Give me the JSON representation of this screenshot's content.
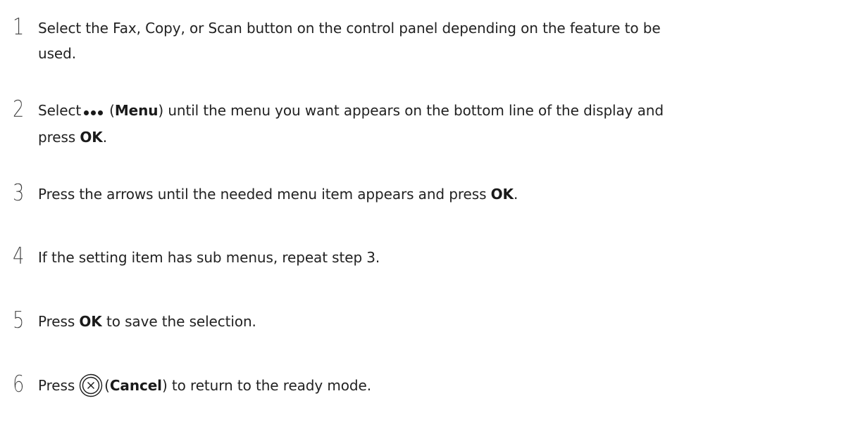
{
  "steps": [
    {
      "number": "1",
      "line1": "Select the Fax, Copy, or Scan button on the control panel depending on the feature to be",
      "line2": "used."
    },
    {
      "number": "2",
      "pre": "Select",
      "open_paren": "(",
      "menu_label": "Menu",
      "post1": ") until the menu you want appears on the bottom line of the display and",
      "line2_pre": "press ",
      "ok_label": "OK",
      "line2_post": "."
    },
    {
      "number": "3",
      "pre": "Press the arrows until the needed menu item appears and press ",
      "ok_label": "OK",
      "post": "."
    },
    {
      "number": "4",
      "text": "If the setting item has sub menus, repeat step 3."
    },
    {
      "number": "5",
      "pre": "Press ",
      "ok_label": "OK",
      "post": " to save the selection."
    },
    {
      "number": "6",
      "pre": "Press",
      "open_paren": "(",
      "cancel_label": "Cancel",
      "post": ") to return to the ready mode."
    }
  ],
  "icons": {
    "menu": "more-dots-icon",
    "cancel": "cancel-circle-icon"
  },
  "colors": {
    "text": "#222222",
    "number": "#3a3a3a"
  }
}
